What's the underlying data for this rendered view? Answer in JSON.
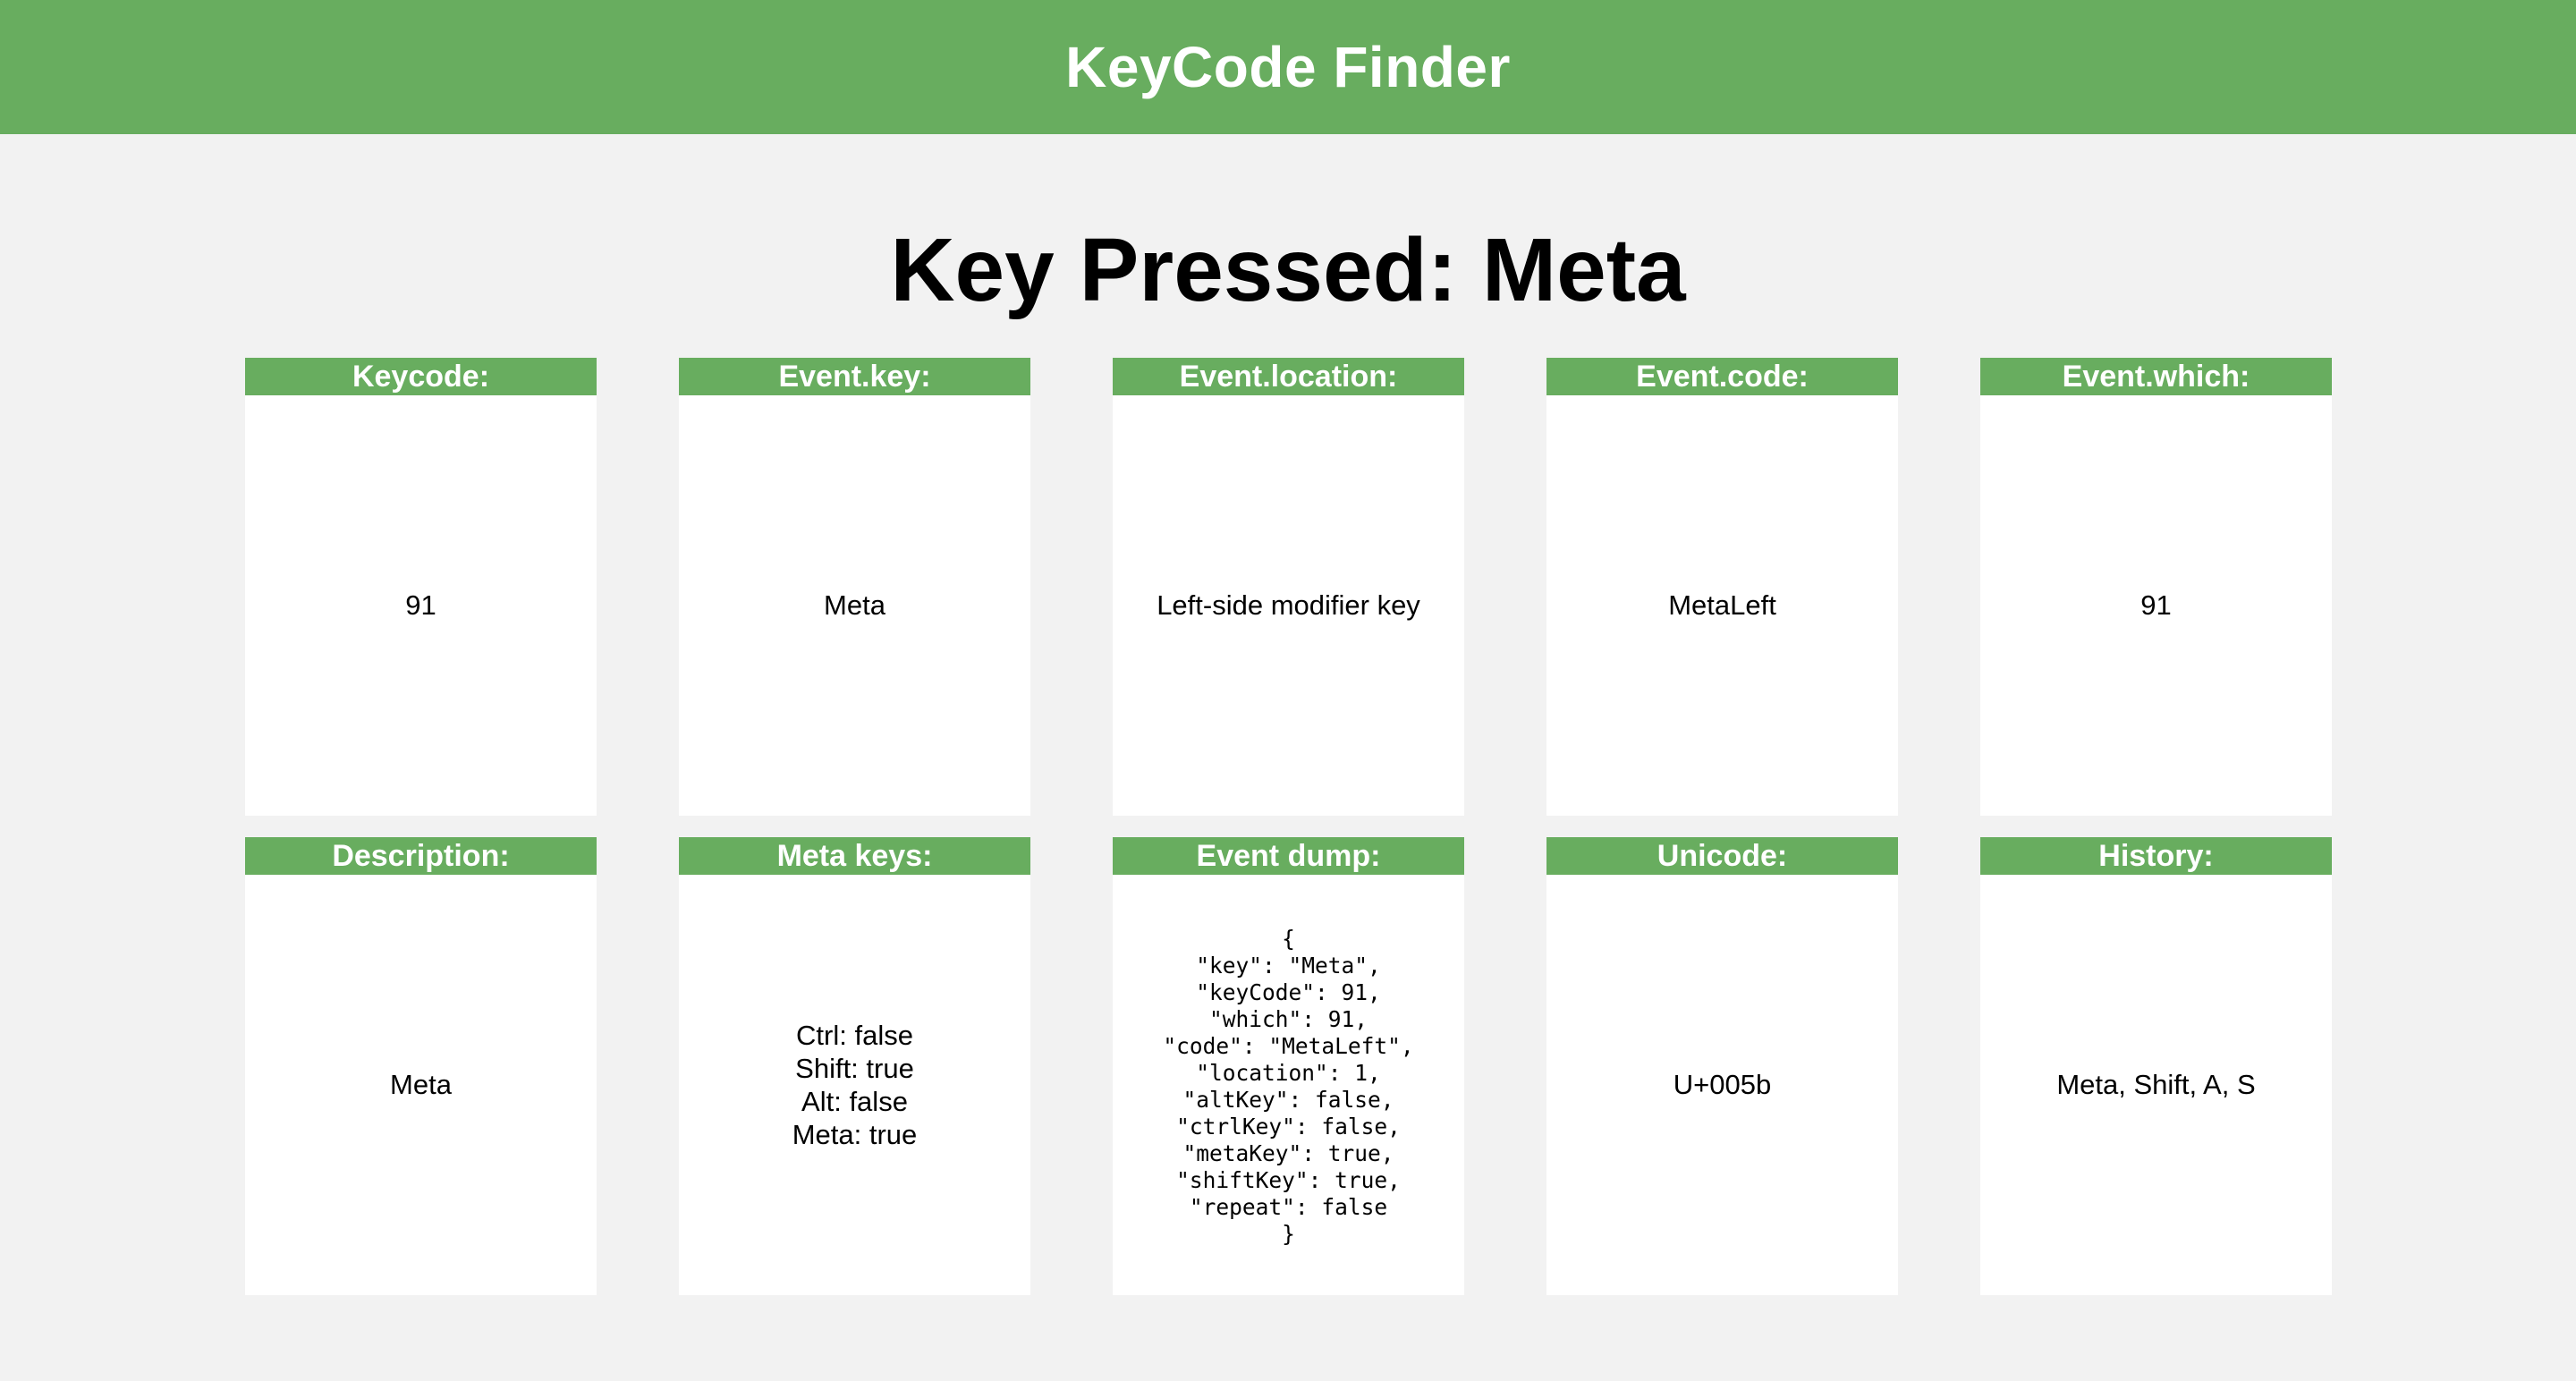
{
  "header": {
    "title": "KeyCode Finder"
  },
  "main": {
    "heading": "Key Pressed: Meta"
  },
  "cards": {
    "keycode": {
      "label": "Keycode:",
      "value": "91"
    },
    "event_key": {
      "label": "Event.key:",
      "value": "Meta"
    },
    "event_location": {
      "label": "Event.location:",
      "value": "Left-side modifier key"
    },
    "event_code": {
      "label": "Event.code:",
      "value": "MetaLeft"
    },
    "event_which": {
      "label": "Event.which:",
      "value": "91"
    },
    "description": {
      "label": "Description:",
      "value": "Meta"
    },
    "meta_keys": {
      "label": "Meta keys:",
      "lines": [
        "Ctrl: false",
        "Shift: true",
        "Alt: false",
        "Meta: true"
      ]
    },
    "event_dump": {
      "label": "Event dump:",
      "lines": [
        "{",
        "\"key\": \"Meta\",",
        "\"keyCode\": 91,",
        "\"which\": 91,",
        "\"code\": \"MetaLeft\",",
        "\"location\": 1,",
        "\"altKey\": false,",
        "\"ctrlKey\": false,",
        "\"metaKey\": true,",
        "\"shiftKey\": true,",
        "\"repeat\": false",
        "}"
      ]
    },
    "unicode": {
      "label": "Unicode:",
      "value": "U+005b"
    },
    "history": {
      "label": "History:",
      "value": "Meta, Shift, A, S"
    }
  },
  "colors": {
    "accent": "#68ad5f",
    "background": "#f2f2f2",
    "card": "#ffffff",
    "text": "#000000"
  }
}
